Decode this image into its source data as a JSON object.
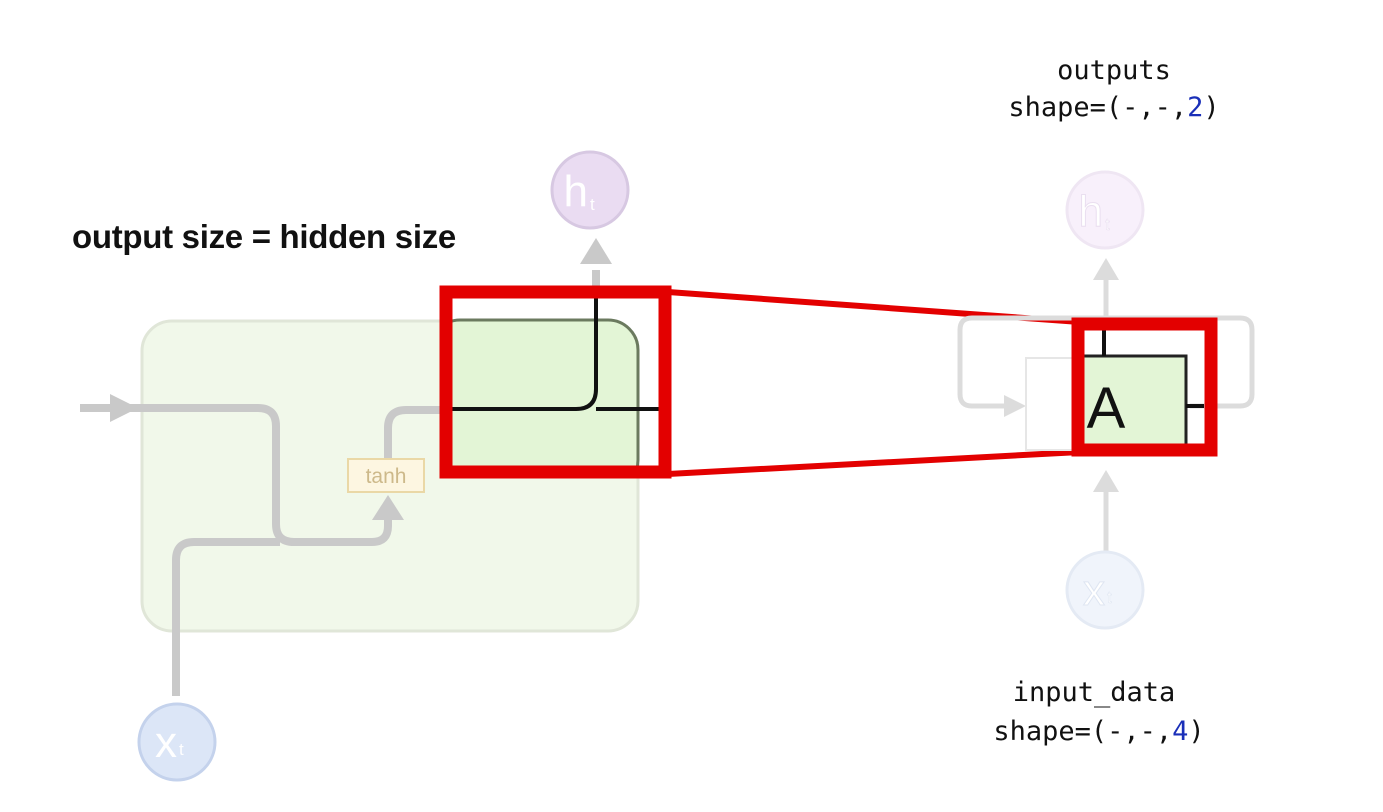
{
  "heading": "output size = hidden size",
  "outputs": {
    "name": "outputs",
    "shape_prefix": "shape=(-,-,",
    "shape_value": "2",
    "shape_suffix": ")"
  },
  "input": {
    "name": "input_data",
    "shape_prefix": "shape=(-,-,",
    "shape_value": "4",
    "shape_suffix": ")"
  },
  "cell": {
    "activation_label": "tanh",
    "block_label": "A"
  },
  "nodes": {
    "hidden_main": {
      "base": "h",
      "sub": "t"
    },
    "hidden_small": {
      "base": "h",
      "sub": "t"
    },
    "input_main": {
      "base": "x",
      "sub": "t"
    },
    "input_small": {
      "base": "x",
      "sub": "t"
    }
  },
  "colors": {
    "highlight": "#e30000",
    "cell_fill": "#e3f5d6",
    "faded_line": "#c9c9c9",
    "hidden_node_fill": "#eadcf2",
    "input_node_fill": "#dce6f7",
    "shape_number": "#1a2fb8"
  }
}
